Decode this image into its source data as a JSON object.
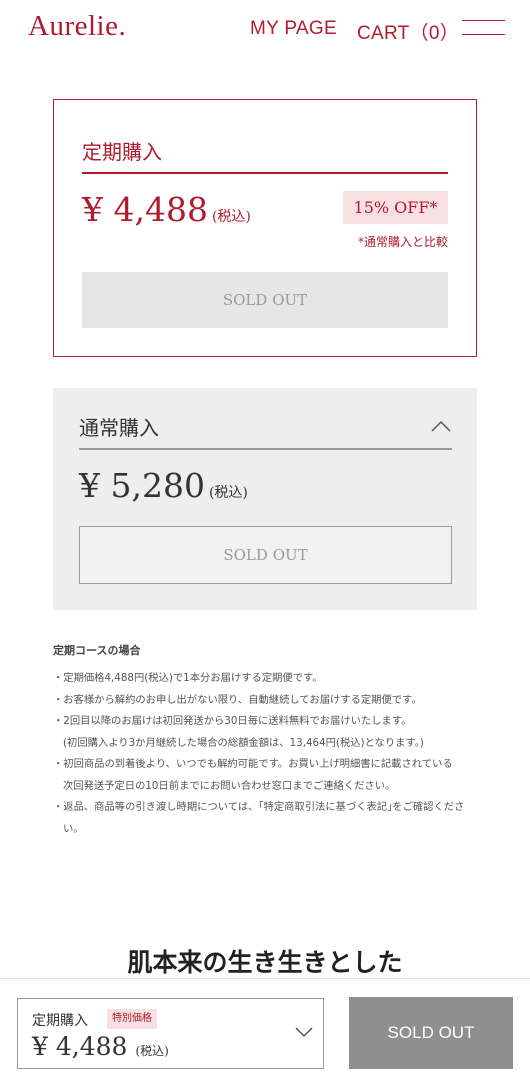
{
  "header": {
    "logo": "Aurelie.",
    "mypage_label": "MY PAGE",
    "cart_label": "CART（0）",
    "menu_icon": "hamburger-menu-icon"
  },
  "subscription": {
    "title": "定期購入",
    "price": "¥ 4,488",
    "tax_label": "(税込)",
    "discount_badge": "15% OFF*",
    "compare_note": "*通常購入と比較",
    "button_label": "SOLD OUT"
  },
  "normal": {
    "title": "通常購入",
    "price": "¥ 5,280",
    "tax_label": "(税込)",
    "button_label": "SOLD OUT",
    "toggle_icon": "chevron-up-icon"
  },
  "notes": {
    "heading": "定期コースの場合",
    "items": [
      "・定期価格4,488円(税込)で1本分お届けする定期便です。",
      "・お客様から解約のお申し出がない限り、自動継続してお届けする定期便です。",
      "・2回目以降のお届けは初回発送から30日毎に送料無料でお届けいたします。\n(初回購入より3か月継続した場合の総額金額は、13,464円(税込)となります。)",
      "・初回商品の到着後より、いつでも解約可能です。お買い上げ明細書に記載されている\n次回発送予定日の10日前までにお問い合わせ窓口までご連絡ください。",
      "・返品、商品等の引き渡し時期については、｢特定商取引法に基づく表記｣をご確認ください。"
    ]
  },
  "section_heading": "肌本来の生き生きとした",
  "bottom_bar": {
    "selected_label": "定期購入",
    "selected_badge": "特別価格",
    "selected_price": "¥ 4,488",
    "tax_label": "(税込)",
    "button_label": "SOLD OUT",
    "dropdown_icon": "chevron-down-icon"
  },
  "colors": {
    "brand": "#b01c2e",
    "badge_bg": "#f7dfe2",
    "panel_bg": "#eeeeee",
    "disabled_button": "#8f8f8f"
  }
}
